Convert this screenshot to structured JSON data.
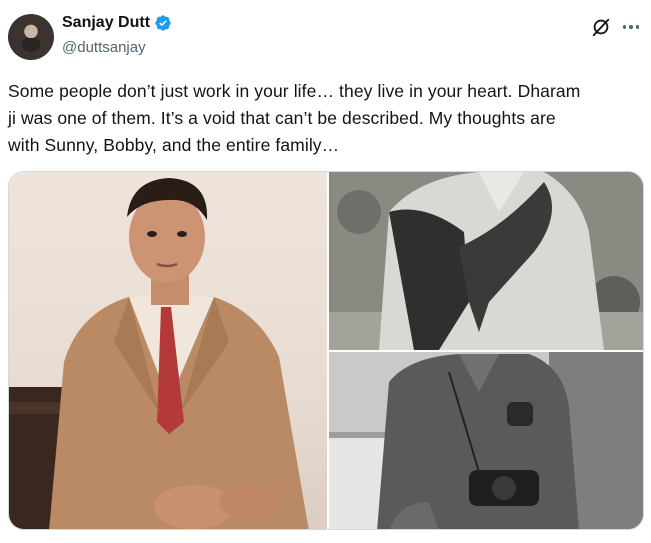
{
  "author": {
    "display_name": "Sanjay Dutt",
    "handle": "@duttsanjay",
    "verified": true
  },
  "header_icons": {
    "grok": "grok-slash-icon",
    "more": "more-dots-icon"
  },
  "tweet": {
    "line1": "Some people don’t just work in your life… they live in your heart. Dharam",
    "line2": "ji was one of them. It’s a void that can’t be described. My thoughts are",
    "line3": "with Sunny, Bobby, and the entire family…"
  },
  "colors": {
    "text": "#0f1419",
    "secondary": "#536471",
    "verified": "#1d9bf0"
  }
}
